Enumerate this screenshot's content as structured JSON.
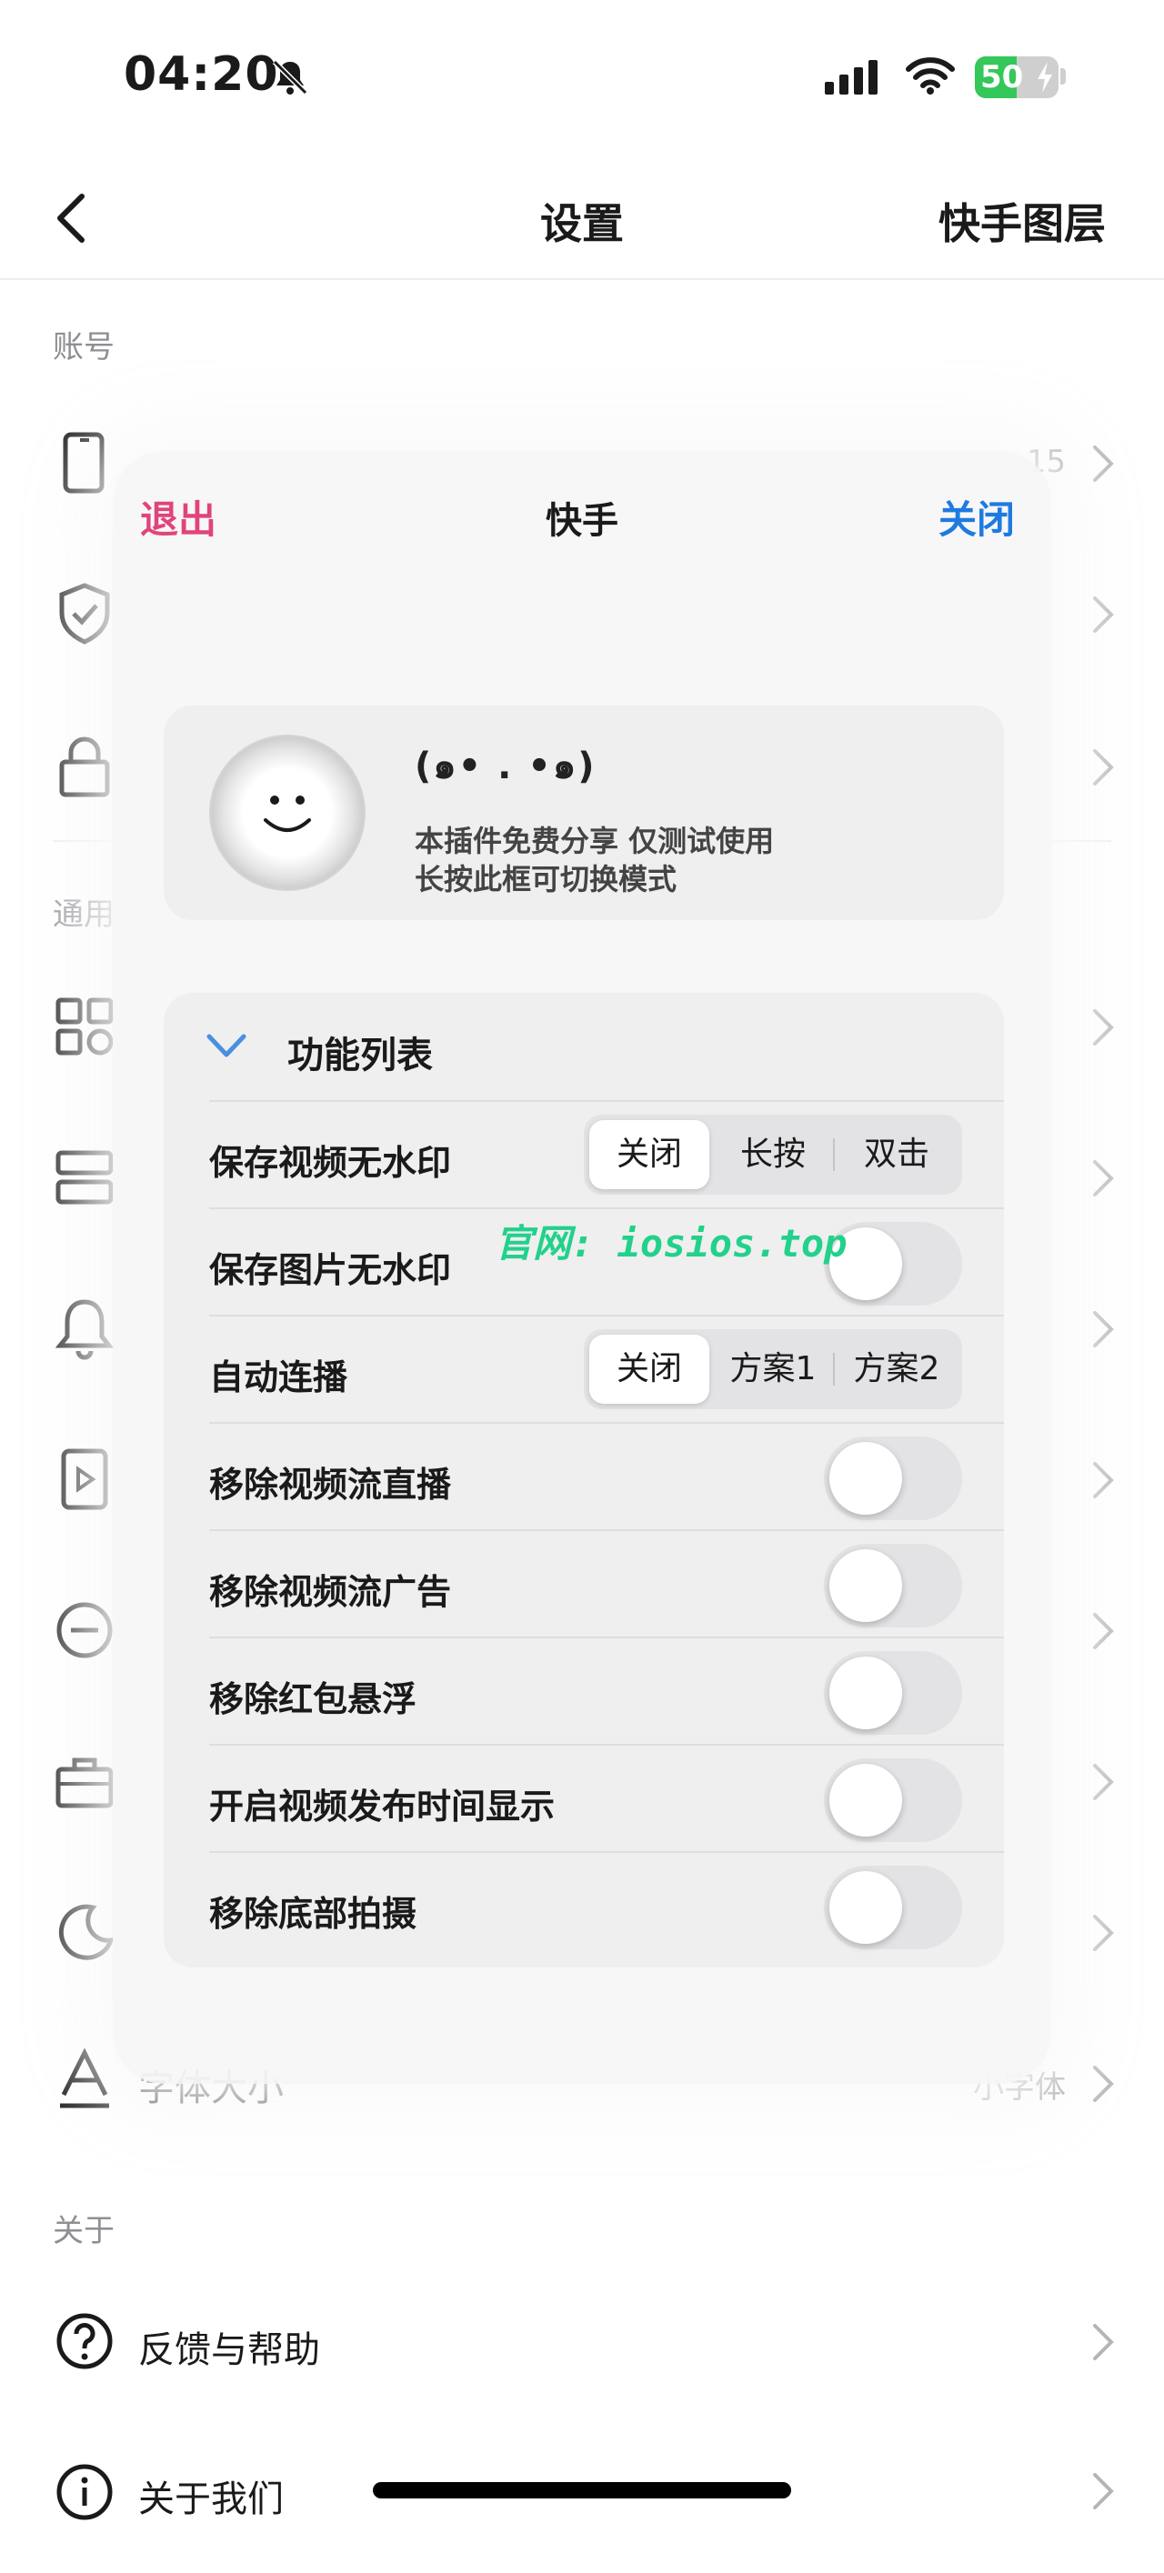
{
  "status_bar": {
    "time": "04:20",
    "battery_percent": "50",
    "battery_level": 0.5
  },
  "nav": {
    "title": "设置",
    "right": "快手图层"
  },
  "sections": {
    "account": "账号",
    "general": "通用",
    "about": "关于"
  },
  "rows": {
    "phone_value": "15",
    "font_size_label": "字体大小",
    "font_size_value": "小字体",
    "feedback_label": "反馈与帮助",
    "about_us_label": "关于我们"
  },
  "panel": {
    "exit": "退出",
    "title": "快手",
    "close": "关闭",
    "kaomoji": "(๑• . •๑)",
    "info_line1": "本插件免费分享 仅测试使用",
    "info_line2": "长按此框可切换模式",
    "func_title": "功能列表",
    "features": {
      "save_video": {
        "label": "保存视频无水印",
        "options": [
          "关闭",
          "长按",
          "双击"
        ],
        "selected": "关闭"
      },
      "save_image": {
        "label": "保存图片无水印",
        "on": false
      },
      "autoplay": {
        "label": "自动连播",
        "options": [
          "关闭",
          "方案1",
          "方案2"
        ],
        "selected": "关闭"
      },
      "remove_live": {
        "label": "移除视频流直播",
        "on": false
      },
      "remove_ads": {
        "label": "移除视频流广告",
        "on": false
      },
      "remove_redpacket": {
        "label": "移除红包悬浮",
        "on": false
      },
      "show_publish_time": {
        "label": "开启视频发布时间显示",
        "on": false
      },
      "remove_bottom_shoot": {
        "label": "移除底部拍摄",
        "on": false
      }
    }
  },
  "watermark": "官网: iosios.top",
  "icons": {
    "status": [
      "bell-slash-icon",
      "cellular-signal-icon",
      "wifi-icon",
      "battery-icon"
    ],
    "rows": [
      "phone-icon",
      "shield-check-icon",
      "lock-icon",
      "grid-apps-icon",
      "layout-rows-icon",
      "bell-icon",
      "video-file-icon",
      "minus-circle-icon",
      "briefcase-icon",
      "moon-icon",
      "font-size-icon",
      "question-circle-icon",
      "info-circle-icon"
    ]
  }
}
